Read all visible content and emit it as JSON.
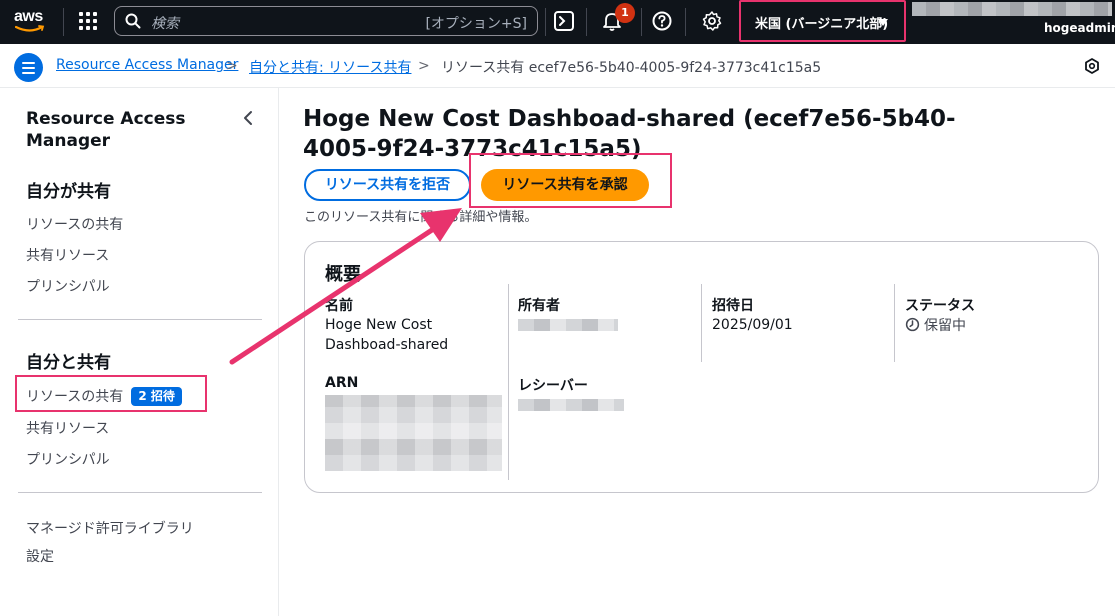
{
  "topnav": {
    "logo_text": "aws",
    "search_placeholder": "検索",
    "search_shortcut": "[オプション+S]",
    "notification_count": "1",
    "region_label": "米国 (バージニア北部)",
    "account_name": "hogeadmin"
  },
  "breadcrumb": {
    "items": [
      {
        "label": "Resource Access Manager"
      },
      {
        "label": "自分と共有: リソース共有"
      },
      {
        "label": "リソース共有 ecef7e56-5b40-4005-9f24-3773c41c15a5"
      }
    ],
    "separator": ">"
  },
  "sidebar": {
    "title": "Resource Access Manager",
    "collapse_icon": "chevron-left-icon",
    "section1": {
      "heading": "自分が共有",
      "items": [
        {
          "label": "リソースの共有"
        },
        {
          "label": "共有リソース"
        },
        {
          "label": "プリンシパル"
        }
      ]
    },
    "section2": {
      "heading": "自分と共有",
      "items": [
        {
          "label": "リソースの共有",
          "badge": "2 招待"
        },
        {
          "label": "共有リソース"
        },
        {
          "label": "プリンシパル"
        }
      ]
    },
    "footer_items": [
      {
        "label": "マネージド許可ライブラリ"
      },
      {
        "label": "設定"
      }
    ]
  },
  "main": {
    "title": "Hoge New Cost Dashboad-shared (ecef7e56-5b40-4005-9f24-3773c41c15a5)",
    "reject_button": "リソース共有を拒否",
    "accept_button": "リソース共有を承認",
    "description": "このリソース共有に関する詳細や情報。",
    "summary": {
      "heading": "概要",
      "name_label": "名前",
      "name_value": "Hoge New Cost Dashboad-shared",
      "owner_label": "所有者",
      "invited_label": "招待日",
      "invited_value": "2025/09/01",
      "status_label": "ステータス",
      "status_value": "保留中",
      "arn_label": "ARN",
      "receiver_label": "レシーバー"
    }
  },
  "colors": {
    "nav_bg": "#0f141a",
    "link": "#006ce0",
    "primary_button": "#ff9900",
    "highlight": "#e8336d",
    "badge": "#006ce0",
    "notification_badge": "#d13212"
  }
}
